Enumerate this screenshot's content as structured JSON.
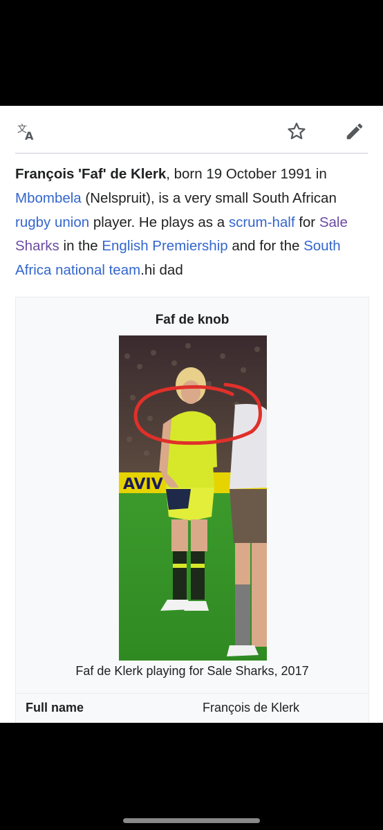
{
  "toolbar": {
    "language_icon": "translate-icon",
    "star_icon": "star-icon",
    "edit_icon": "pencil-icon"
  },
  "intro": {
    "name": "François 'Faf' de Klerk",
    "t1": ", born 19 October 1991 in ",
    "link_mbombela": "Mbombela",
    "t2": " (Nelspruit), is a very small South African ",
    "link_rugby": "rugby union",
    "t3": " player. He plays as a ",
    "link_scrum": "scrum-half",
    "t4": " for ",
    "link_sale": "Sale Sharks",
    "t5": " in the ",
    "link_premiership": "English Premiership",
    "t6": " and for the ",
    "link_national": "South Africa national team",
    "t7": ".hi dad"
  },
  "infobox": {
    "title": "Faf de knob",
    "caption": "Faf de Klerk playing for Sale Sharks, 2017",
    "rows": [
      {
        "label": "Full name",
        "value": "François de Klerk"
      }
    ]
  },
  "colors": {
    "link": "#3366cc",
    "visited_link": "#6b4ba1",
    "annotation": "#e0302a"
  }
}
